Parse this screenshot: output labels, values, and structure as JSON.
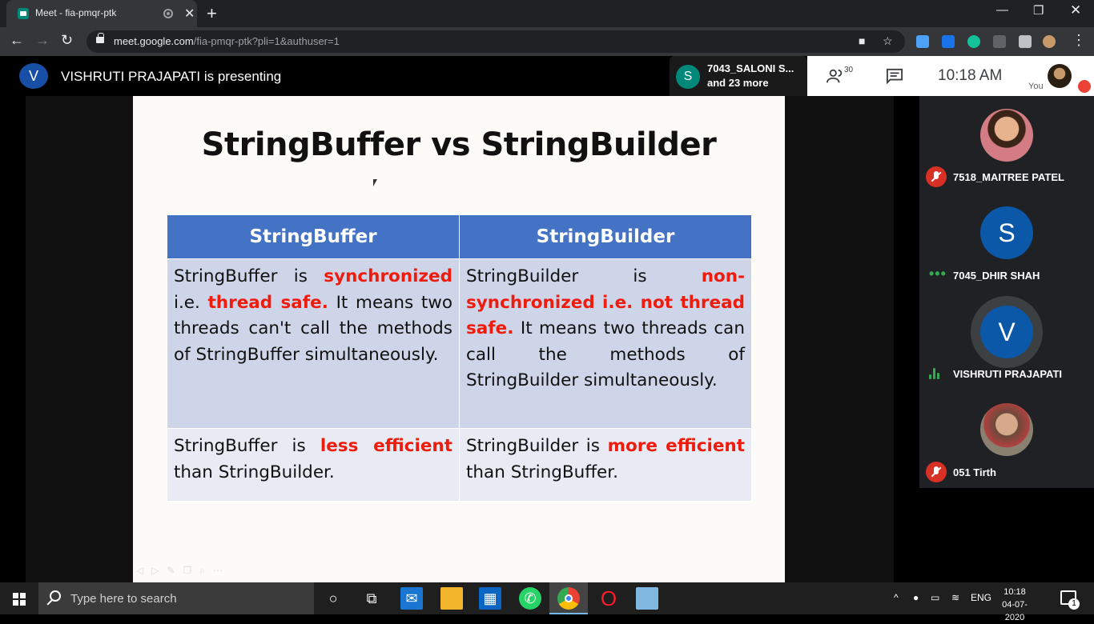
{
  "browser": {
    "tab_title": "Meet - fia-pmqr-ptk",
    "url_host": "meet.google.com",
    "url_path": "/fia-pmqr-ptk?pli=1&authuser=1"
  },
  "meet": {
    "presenter_initial": "V",
    "presenter_text": "VISHRUTI PRAJAPATI is presenting",
    "speaker_initial": "S",
    "speaker_name": "7043_SALONI S...",
    "speaker_more": "and 23 more",
    "people_count": "30",
    "clock": "10:18  AM",
    "you_label": "You"
  },
  "slide": {
    "title": "StringBuffer vs StringBuilder",
    "col1_header": "StringBuffer",
    "col2_header": "StringBuilder",
    "r1c1": {
      "a": "StringBuffer is ",
      "hl": "synchronized",
      "b": " i.e. ",
      "hl2": "thread safe.",
      "c": " It means two threads can't call the methods of StringBuffer simultaneously."
    },
    "r1c2": {
      "a": "StringBuilder is ",
      "hl": "non-synchronized i.e. not thread safe.",
      "b": " It means two threads can call the methods of StringBuilder simultaneously."
    },
    "r2c1": {
      "a": "StringBuffer is ",
      "hl": "less efficient",
      "b": " than StringBuilder."
    },
    "r2c2": {
      "a": "StringBuilder is ",
      "hl": "more efficient",
      "b": " than StringBuffer."
    }
  },
  "participants": [
    {
      "name": "7518_MAITREE PATEL",
      "initial": "",
      "status": "muted"
    },
    {
      "name": "7045_DHIR SHAH",
      "initial": "S",
      "status": "idle"
    },
    {
      "name": "VISHRUTI PRAJAPATI",
      "initial": "V",
      "status": "speaking"
    },
    {
      "name": "051 Tirth",
      "initial": "",
      "status": "muted"
    }
  ],
  "taskbar": {
    "search_placeholder": "Type here to search",
    "lang": "ENG",
    "time": "10:18",
    "date": "04-07-2020",
    "notif_count": "1"
  },
  "colors": {
    "table_header": "#4472c4",
    "highlight": "#ee1c0d",
    "meet_green": "#34a853",
    "mute_red": "#d93025"
  }
}
